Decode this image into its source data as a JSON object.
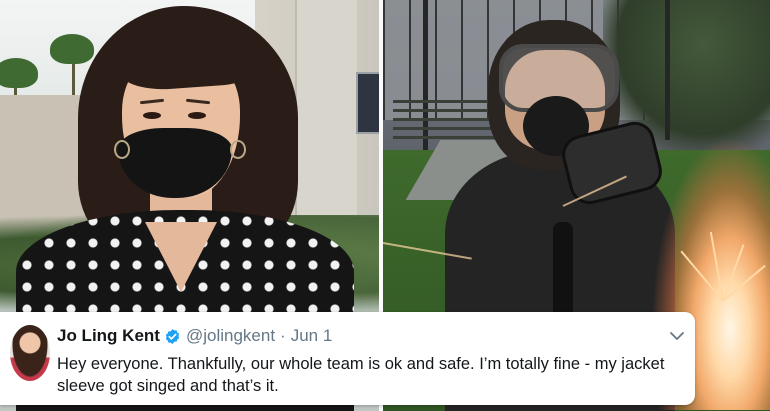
{
  "tweet": {
    "display_name": "Jo Ling Kent",
    "handle": "@jolingkent",
    "separator": "·",
    "date": "Jun 1",
    "text": "Hey everyone. Thankfully, our whole team is ok and safe. I’m totally fine - my jacket sleeve got singed and that’s it."
  },
  "icons": {
    "verified": "verified-badge-icon",
    "menu": "chevron-down-icon"
  },
  "colors": {
    "verified_blue": "#1da1f2",
    "name_text": "#14171a",
    "secondary_text": "#657786",
    "card_background": "#ffffff"
  }
}
